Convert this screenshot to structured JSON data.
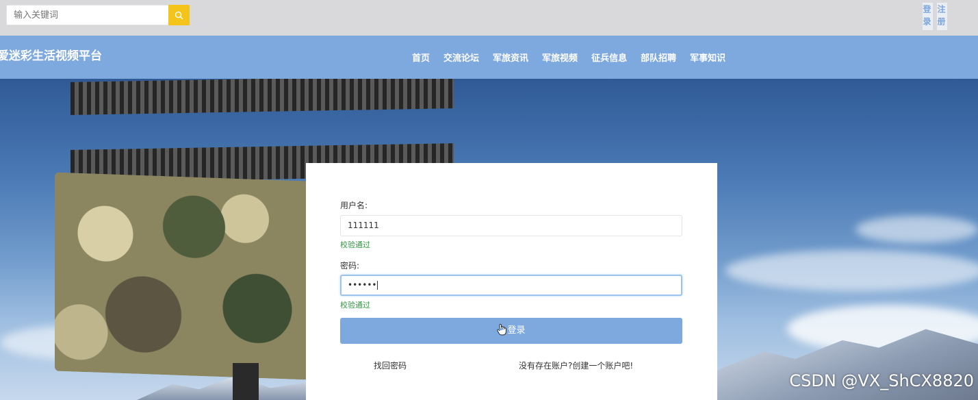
{
  "search": {
    "placeholder": "输入关键词"
  },
  "auth": {
    "login": "登录",
    "register": "注册"
  },
  "site": {
    "title": "爱迷彩生活视频平台"
  },
  "nav": {
    "items": [
      {
        "label": "首页"
      },
      {
        "label": "交流论坛"
      },
      {
        "label": "军旅资讯"
      },
      {
        "label": "军旅视频"
      },
      {
        "label": "征兵信息"
      },
      {
        "label": "部队招聘"
      },
      {
        "label": "军事知识"
      }
    ]
  },
  "login_form": {
    "username_label": "用户名:",
    "username_value": "111111",
    "username_valid": "校验通过",
    "password_label": "密码:",
    "password_value": "••••••",
    "password_valid": "校验通过",
    "submit_label": "登录",
    "forgot_link": "找回密码",
    "register_link": "没有存在账户?创建一个账户吧!"
  },
  "watermark": "CSDN @VX_ShCX8820",
  "colors": {
    "accent": "#7ea9df",
    "search_button": "#f4c41b",
    "valid": "#2e9b3e"
  }
}
